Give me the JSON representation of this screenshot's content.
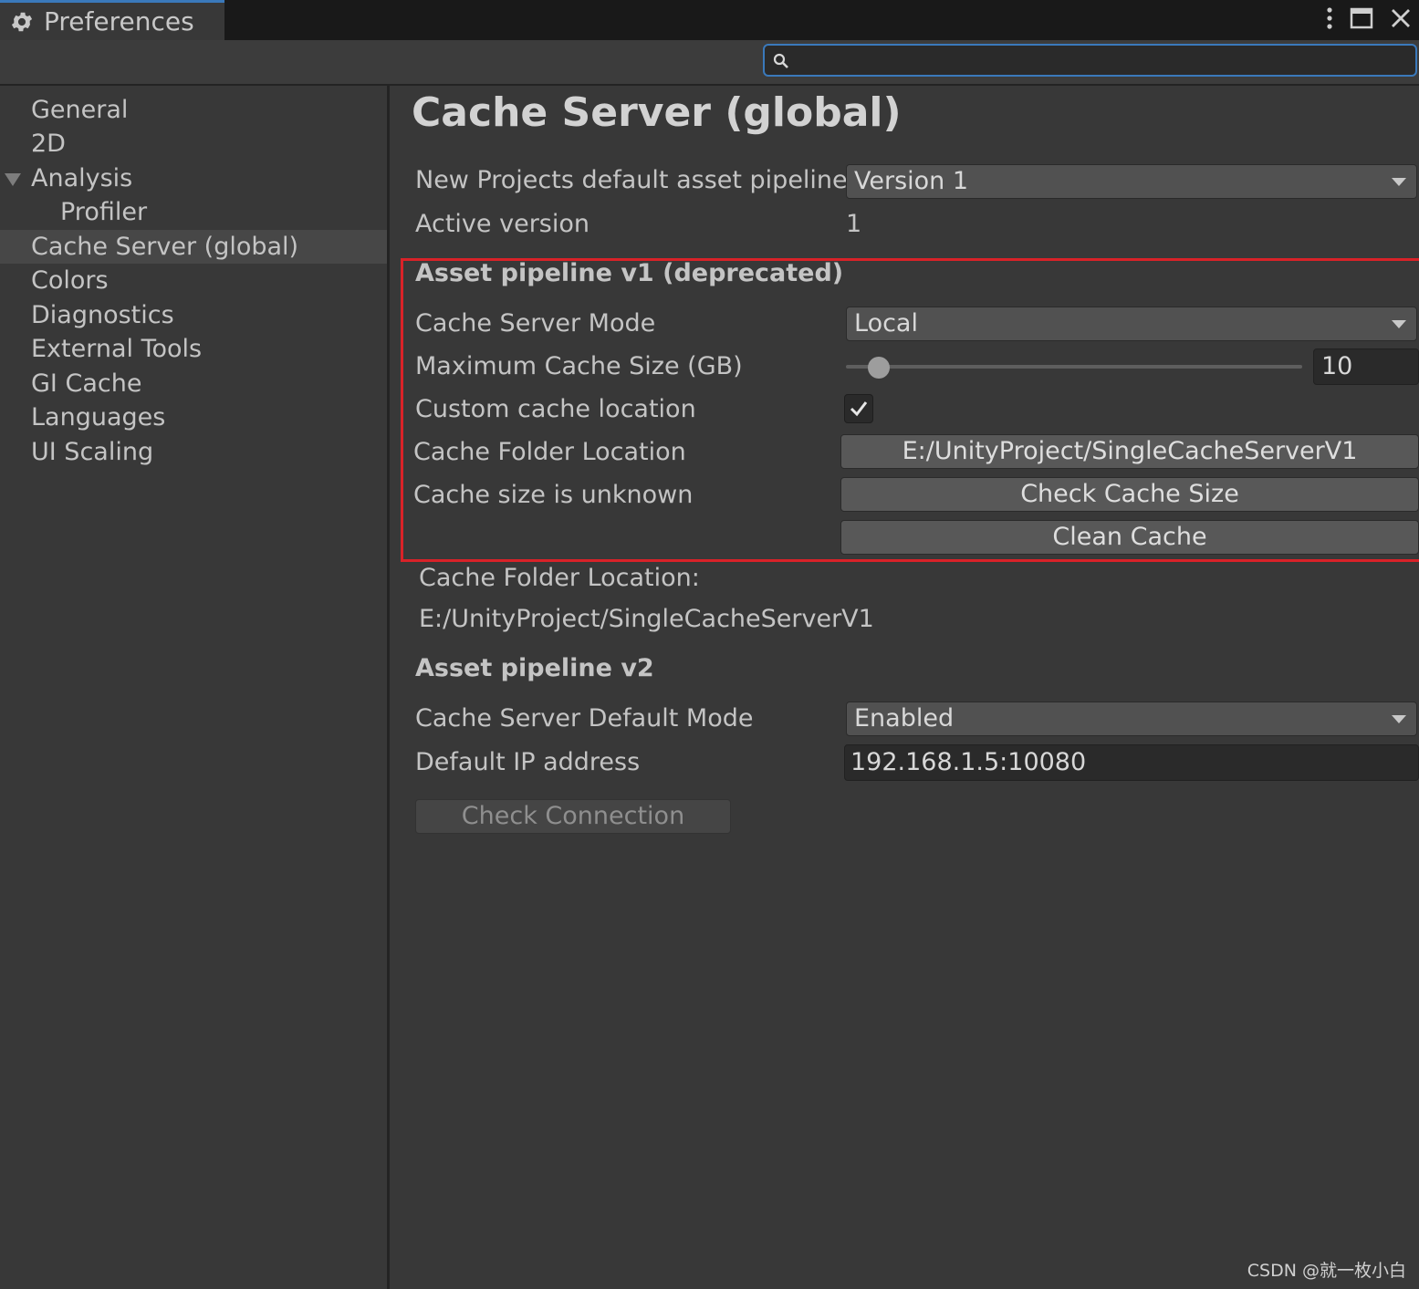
{
  "window": {
    "title": "Preferences",
    "colors": {
      "accent": "#3a79bb",
      "highlight": "#d92228",
      "background": "#383838"
    }
  },
  "search": {
    "placeholder": "",
    "value": ""
  },
  "sidebar": {
    "items": [
      {
        "label": "General"
      },
      {
        "label": "2D"
      },
      {
        "label": "Analysis",
        "expanded": true
      },
      {
        "label": "Profiler"
      },
      {
        "label": "Cache Server (global)",
        "selected": true
      },
      {
        "label": "Colors"
      },
      {
        "label": "Diagnostics"
      },
      {
        "label": "External Tools"
      },
      {
        "label": "GI Cache"
      },
      {
        "label": "Languages"
      },
      {
        "label": "UI Scaling"
      }
    ]
  },
  "main": {
    "title": "Cache Server (global)",
    "default_pipeline": {
      "label": "New Projects default asset pipeline",
      "value": "Version 1"
    },
    "active_version": {
      "label": "Active version",
      "value": "1"
    },
    "v1": {
      "heading": "Asset pipeline v1 (deprecated)",
      "mode": {
        "label": "Cache Server Mode",
        "value": "Local"
      },
      "max_size": {
        "label": "Maximum Cache Size (GB)",
        "value": "10",
        "slider_fraction": 0.06
      },
      "custom_location": {
        "label": "Custom cache location",
        "checked": true
      },
      "folder": {
        "label": "Cache Folder Location",
        "button": "E:/UnityProject/SingleCacheServerV1"
      },
      "size": {
        "label": "Cache size is unknown",
        "button": "Check Cache Size"
      },
      "clean_button": "Clean Cache"
    },
    "folder_info": {
      "label": "Cache Folder Location:",
      "path": "E:/UnityProject/SingleCacheServerV1"
    },
    "v2": {
      "heading": "Asset pipeline v2",
      "mode": {
        "label": "Cache Server Default Mode",
        "value": "Enabled"
      },
      "ip": {
        "label": "Default IP address",
        "value": "192.168.1.5:10080"
      },
      "check_button": "Check Connection"
    }
  },
  "watermark": "CSDN @就一枚小白"
}
